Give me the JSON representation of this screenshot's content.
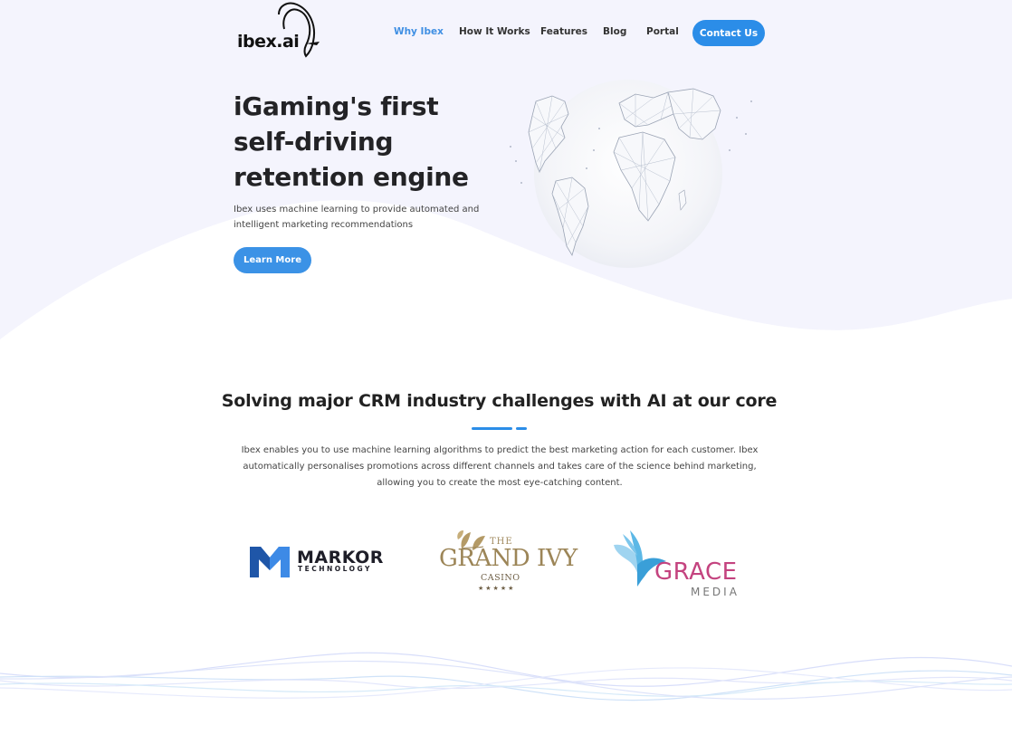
{
  "header": {
    "logo_text": "ibex.ai",
    "nav": [
      {
        "label": "Why Ibex",
        "active": true
      },
      {
        "label": "How It Works",
        "active": false
      },
      {
        "label": "Features",
        "active": false
      },
      {
        "label": "Blog",
        "active": false
      },
      {
        "label": "Portal",
        "active": false
      }
    ],
    "contact_label": "Contact Us"
  },
  "hero": {
    "title": "iGaming's first self-driving retention engine",
    "subtitle": "Ibex uses machine learning to provide automated and intelligent marketing recommendations",
    "cta_label": "Learn More"
  },
  "section": {
    "title": "Solving major CRM industry challenges with AI at our core",
    "body": "Ibex enables you to use machine learning algorithms to predict the best marketing action for each customer. Ibex automatically personalises promotions across different channels and takes care of the science behind marketing, allowing you to create the most eye-catching content."
  },
  "partners": {
    "markor": {
      "name": "MARKOR",
      "sub": "TECHNOLOGY"
    },
    "grandivy": {
      "the": "THE",
      "name": "GRAND IVY",
      "casino": "CASINO",
      "stars": "★★★★★"
    },
    "grace": {
      "name": "GRACE",
      "sub": "MEDIA"
    }
  },
  "colors": {
    "accent": "#2b8de8",
    "hero_bg": "#f4f4fd",
    "markor_blue": "#2a6fd1",
    "ivy_gold": "#9c8557",
    "grace_pink": "#c4437f",
    "grace_bird": "#5cb8e6"
  }
}
